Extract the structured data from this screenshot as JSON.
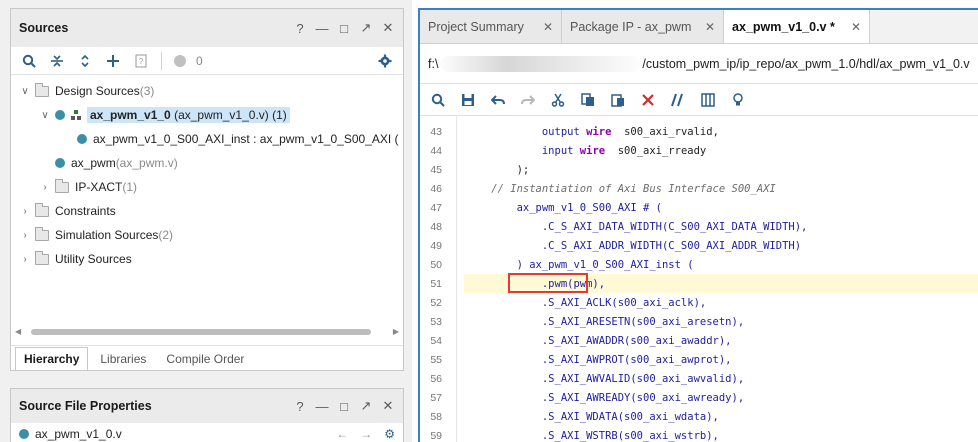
{
  "sources": {
    "title": "Sources",
    "toolbar_count": "0",
    "tree": [
      {
        "text": "Design Sources",
        "suffix": " (3)"
      },
      {
        "text": "ax_pwm_v1_0",
        "suffix": " (ax_pwm_v1_0.v) (1)"
      },
      {
        "text": "ax_pwm_v1_0_S00_AXI_inst : ax_pwm_v1_0_S00_AXI (",
        "suffix": ""
      },
      {
        "text": "ax_pwm",
        "suffix": " (ax_pwm.v)"
      },
      {
        "text": "IP-XACT",
        "suffix": " (1)"
      },
      {
        "text": "Constraints",
        "suffix": ""
      },
      {
        "text": "Simulation Sources",
        "suffix": " (2)"
      },
      {
        "text": "Utility Sources",
        "suffix": ""
      }
    ],
    "bottom_tabs": [
      "Hierarchy",
      "Libraries",
      "Compile Order"
    ]
  },
  "properties": {
    "title": "Source File Properties",
    "file": "ax_pwm_v1_0.v"
  },
  "editor": {
    "tabs": [
      "Project Summary",
      "Package IP - ax_pwm",
      "ax_pwm_v1_0.v *"
    ],
    "path_prefix": "f:\\",
    "path_suffix": "/custom_pwm_ip/ip_repo/ax_pwm_1.0/hdl/ax_pwm_v1_0.v",
    "lines": [
      {
        "n": "43",
        "t": "            output wire  s00_axi_rvalid,"
      },
      {
        "n": "44",
        "t": "            input wire  s00_axi_rready"
      },
      {
        "n": "45",
        "t": "        );"
      },
      {
        "n": "46",
        "t": "    // Instantiation of Axi Bus Interface S00_AXI"
      },
      {
        "n": "47",
        "t": "        ax_pwm_v1_0_S00_AXI # ("
      },
      {
        "n": "48",
        "t": "            .C_S_AXI_DATA_WIDTH(C_S00_AXI_DATA_WIDTH),"
      },
      {
        "n": "49",
        "t": "            .C_S_AXI_ADDR_WIDTH(C_S00_AXI_ADDR_WIDTH)"
      },
      {
        "n": "50",
        "t": "        ) ax_pwm_v1_0_S00_AXI_inst ("
      },
      {
        "n": "51",
        "t": "            .pwm(pwm),"
      },
      {
        "n": "52",
        "t": "            .S_AXI_ACLK(s00_axi_aclk),"
      },
      {
        "n": "53",
        "t": "            .S_AXI_ARESETN(s00_axi_aresetn),"
      },
      {
        "n": "54",
        "t": "            .S_AXI_AWADDR(s00_axi_awaddr),"
      },
      {
        "n": "55",
        "t": "            .S_AXI_AWPROT(s00_axi_awprot),"
      },
      {
        "n": "56",
        "t": "            .S_AXI_AWVALID(s00_axi_awvalid),"
      },
      {
        "n": "57",
        "t": "            .S_AXI_AWREADY(s00_axi_awready),"
      },
      {
        "n": "58",
        "t": "            .S_AXI_WDATA(s00_axi_wdata),"
      },
      {
        "n": "59",
        "t": "            .S_AXI_WSTRB(s00_axi_wstrb),"
      }
    ]
  },
  "colors": {
    "accent": "#3b7fc4",
    "highlight_line": "#fff9d6",
    "annotation_box": "#e53935",
    "selected_row": "#cde6f7"
  }
}
